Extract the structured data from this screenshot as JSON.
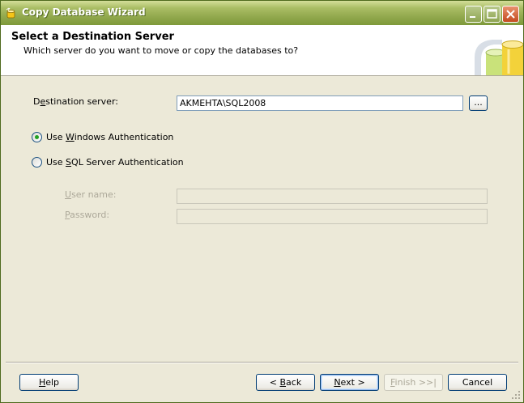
{
  "window": {
    "title": "Copy Database Wizard",
    "icon": "wizard-app-icon",
    "controls": [
      "minimize-icon",
      "maximize-icon",
      "close-icon"
    ]
  },
  "header": {
    "title": "Select a Destination Server",
    "subtitle": "Which server do you want to move or copy the databases to?",
    "graphic": "database-cylinder-icon"
  },
  "form": {
    "destination_label_pre": "D",
    "destination_label_key": "e",
    "destination_label_post": "stination server:",
    "destination_value": "AKMEHTA\\SQL2008",
    "browse_label": "...",
    "auth_windows_pre": "Use ",
    "auth_windows_key": "W",
    "auth_windows_post": "indows Authentication",
    "auth_windows_selected": true,
    "auth_sql_pre": "Use ",
    "auth_sql_key": "S",
    "auth_sql_post": "QL Server Authentication",
    "auth_sql_selected": false,
    "username_key": "U",
    "username_post": "ser name:",
    "username_value": "",
    "password_key": "P",
    "password_post": "assword:",
    "password_value": ""
  },
  "footer": {
    "help_key": "H",
    "help_post": "elp",
    "back_pre": "< ",
    "back_key": "B",
    "back_post": "ack",
    "next_key": "N",
    "next_post": "ext >",
    "finish_key": "F",
    "finish_post": "inish >>|",
    "cancel_label": "Cancel"
  },
  "colors": {
    "titlebar": "#8FA64B",
    "dialog_bg": "#ECE9D8",
    "radio_dot": "#21A121",
    "button_border": "#003C74"
  }
}
